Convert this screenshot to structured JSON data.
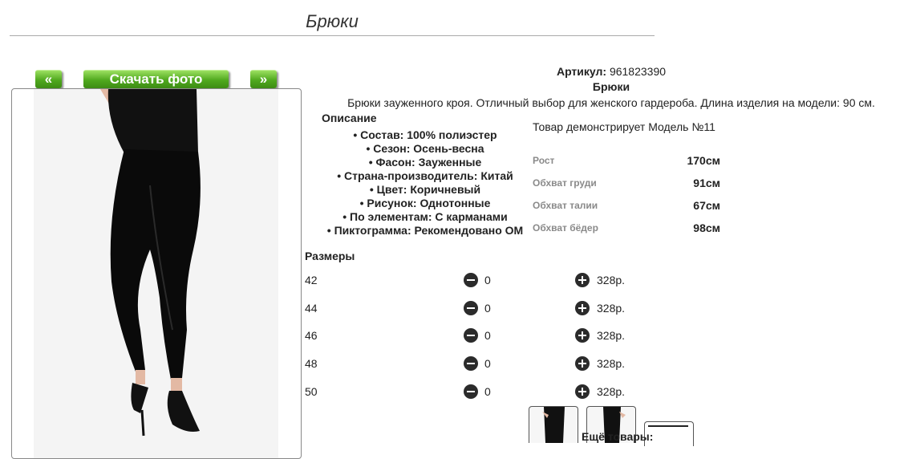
{
  "page": {
    "title": "Брюки"
  },
  "gallery": {
    "prev_label": "«",
    "download_label": "Скачать фото",
    "next_label": "»"
  },
  "product": {
    "sku_label": "Артикул:",
    "sku": "961823390",
    "name": "Брюки",
    "summary": "Брюки зауженного кроя. Отличный выбор для женского гардероба. Длина изделия на модели: 90 см.",
    "description_title": "Описание",
    "features": [
      "• Состав: 100% полиэстер",
      "• Сезон: Осень-весна",
      "• Фасон: Зауженные",
      "• Страна-производитель: Китай",
      "• Цвет: Коричневый",
      "• Рисунок: Однотонные",
      "• По элементам: С карманами",
      "• Пиктограмма: Рекомендовано ОМ"
    ]
  },
  "model": {
    "title": "Товар демонстрирует Модель №11",
    "measurements": [
      {
        "label": "Рост",
        "value": "170см"
      },
      {
        "label": "Обхват груди",
        "value": "91см"
      },
      {
        "label": "Обхват талии",
        "value": "67см"
      },
      {
        "label": "Обхват бёдер",
        "value": "98см"
      }
    ]
  },
  "sizes": {
    "title": "Размеры",
    "rows": [
      {
        "size": "42",
        "qty": "0",
        "price": "328р."
      },
      {
        "size": "44",
        "qty": "0",
        "price": "328р."
      },
      {
        "size": "46",
        "qty": "0",
        "price": "328р."
      },
      {
        "size": "48",
        "qty": "0",
        "price": "328р."
      },
      {
        "size": "50",
        "qty": "0",
        "price": "328р."
      }
    ]
  },
  "more": {
    "label": "Ещё товары:"
  },
  "colors": {
    "button_green": "#4fa81e",
    "icon_dark": "#2b2b2b",
    "muted_label": "#8a8a8a"
  },
  "icons": {
    "minus": "minus-circle-icon",
    "plus": "plus-circle-icon"
  }
}
